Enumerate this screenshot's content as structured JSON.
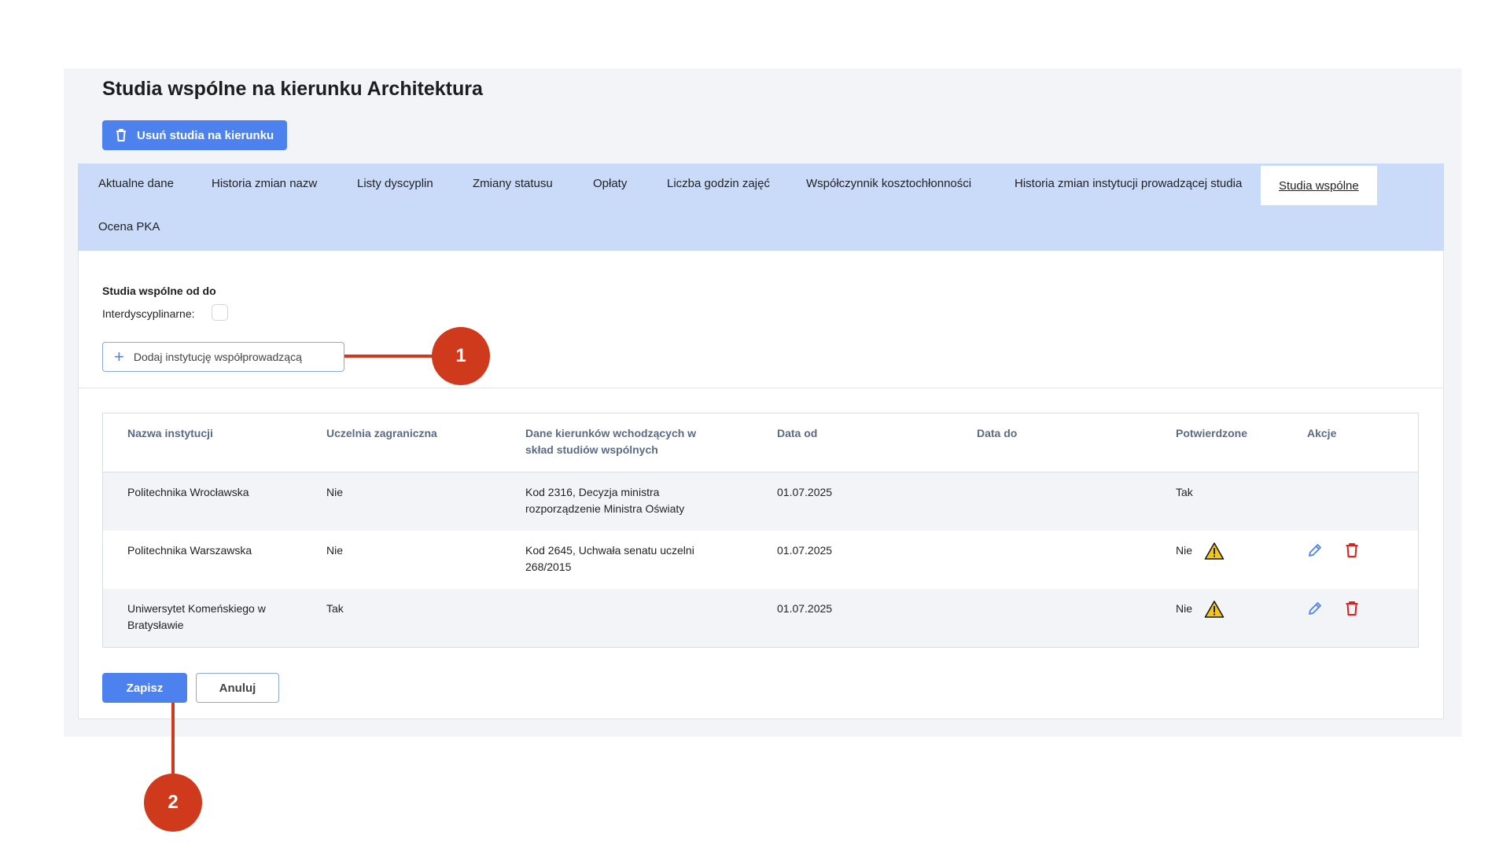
{
  "page": {
    "title": "Studia wspólne na kierunku Architektura",
    "delete_button_label": "Usuń studia na kierunku"
  },
  "tabs": [
    {
      "label": "Aktualne dane"
    },
    {
      "label": "Historia zmian nazw"
    },
    {
      "label": "Listy dyscyplin"
    },
    {
      "label": "Zmiany statusu"
    },
    {
      "label": "Opłaty"
    },
    {
      "label": "Liczba godzin zajęć"
    },
    {
      "label": "Współczynnik kosztochłonności"
    },
    {
      "label": "Historia zmian instytucji prowadzącej studia"
    },
    {
      "label": "Studia wspólne",
      "active": true
    },
    {
      "label": "Ocena PKA"
    }
  ],
  "section": {
    "title": "Studia wspólne od do",
    "interdisciplinary_label": "Interdyscyplinarne:",
    "interdisciplinary_checked": false,
    "add_button_label": "Dodaj instytucję współprowadzącą"
  },
  "table": {
    "headers": [
      "Nazwa instytucji",
      "Uczelnia zagraniczna",
      "Dane kierunków wchodzących w skład studiów wspólnych",
      "Data od",
      "Data do",
      "Potwierdzone",
      "Akcje"
    ],
    "rows": [
      {
        "name": "Politechnika Wrocławska",
        "foreign": "Nie",
        "program_data": "Kod 2316, Decyzja ministra rozporządzenie Ministra Oświaty",
        "date_from": "01.07.2025",
        "date_to": "",
        "confirmed": "Tak",
        "warning": false,
        "actions": false
      },
      {
        "name": "Politechnika Warszawska",
        "foreign": "Nie",
        "program_data": "Kod 2645, Uchwała senatu uczelni 268/2015",
        "date_from": "01.07.2025",
        "date_to": "",
        "confirmed": "Nie",
        "warning": true,
        "actions": true
      },
      {
        "name": "Uniwersytet Komeńskiego w Bratysławie",
        "foreign": "Tak",
        "program_data": "",
        "date_from": "01.07.2025",
        "date_to": "",
        "confirmed": "Nie",
        "warning": true,
        "actions": true
      }
    ]
  },
  "footer": {
    "save_label": "Zapisz",
    "cancel_label": "Anuluj"
  },
  "callouts": [
    "1",
    "2"
  ],
  "colors": {
    "primary": "#4d82ee",
    "tab_bar": "#c9dbf9",
    "callout": "#cf3a1c",
    "warning": "#f5c518",
    "delete": "#e0201c"
  }
}
